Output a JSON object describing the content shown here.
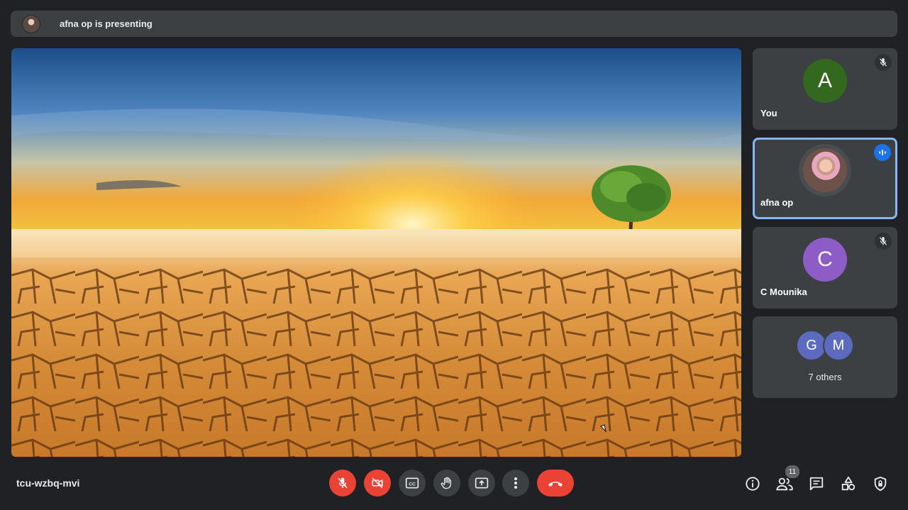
{
  "banner": {
    "text": "afna op is presenting"
  },
  "participants": [
    {
      "name": "You",
      "initial": "A",
      "color": "#33691e",
      "muted": true
    },
    {
      "name": "afna op",
      "speaking": true
    },
    {
      "name": "C Mounika",
      "initial": "C",
      "color": "#8e5cc7",
      "muted": true
    }
  ],
  "others": {
    "avatars": [
      {
        "initial": "G",
        "color": "#5c6bc0"
      },
      {
        "initial": "M",
        "color": "#5c6bc0"
      }
    ],
    "label": "7 others"
  },
  "footer": {
    "meeting_code": "tcu-wzbq-mvi",
    "people_count": "11",
    "captions_label": "CC"
  },
  "colors": {
    "end_call": "#ea4335",
    "active_border": "#8ab4f8",
    "speaking_badge": "#1a73e8"
  }
}
